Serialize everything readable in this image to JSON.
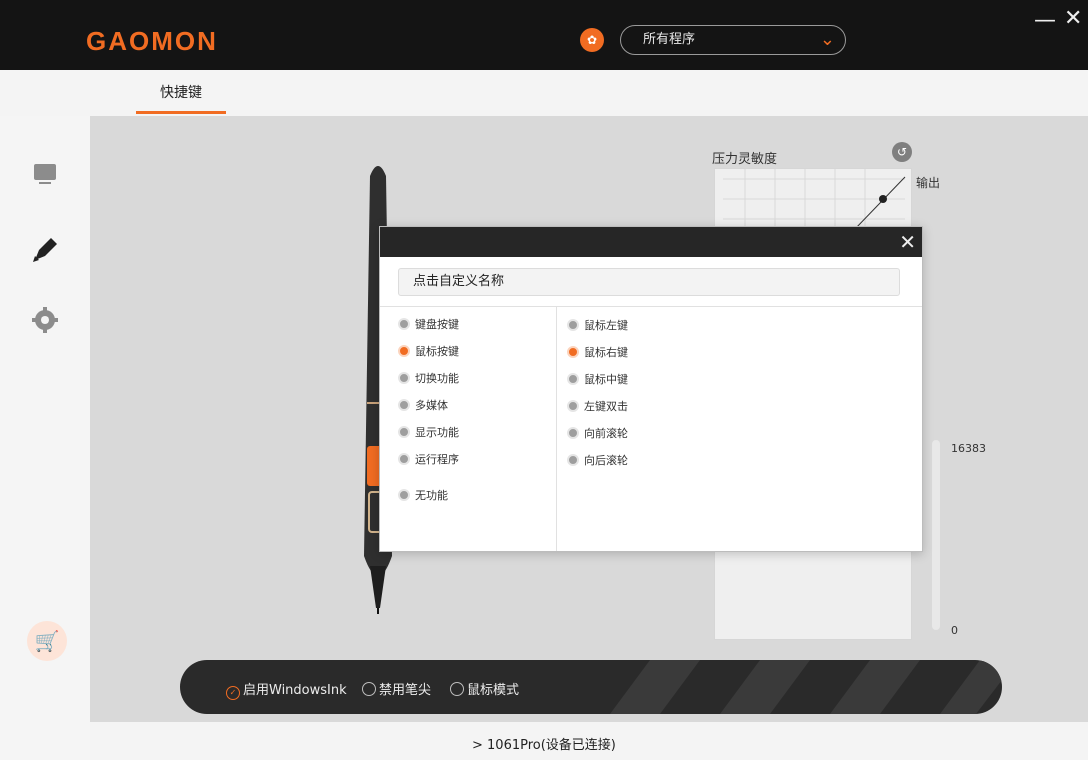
{
  "app": {
    "logo": "GAOMON",
    "program_select_value": "所有程序",
    "window_controls": {
      "minimize": "—",
      "close": "✕"
    }
  },
  "tabs": [
    {
      "label": "快捷键",
      "active": true
    }
  ],
  "sidebar": {
    "items": [
      {
        "icon": "monitor-icon"
      },
      {
        "icon": "pen-icon",
        "active": true
      },
      {
        "icon": "gear-icon"
      }
    ],
    "cart_icon": "cart-icon"
  },
  "pressure": {
    "title": "压力灵敏度",
    "output_label": "输出",
    "max_value": "16383",
    "min_value": "0"
  },
  "dialog": {
    "name_value": "点击自定义名称",
    "categories": [
      {
        "label": "键盘按键",
        "selected": false
      },
      {
        "label": "鼠标按键",
        "selected": true
      },
      {
        "label": "切换功能",
        "selected": false
      },
      {
        "label": "多媒体",
        "selected": false
      },
      {
        "label": "显示功能",
        "selected": false
      },
      {
        "label": "运行程序",
        "selected": false
      },
      {
        "label": "无功能",
        "selected": false
      }
    ],
    "mouse_options": [
      {
        "label": "鼠标左键",
        "selected": false
      },
      {
        "label": "鼠标右键",
        "selected": true
      },
      {
        "label": "鼠标中键",
        "selected": false
      },
      {
        "label": "左键双击",
        "selected": false
      },
      {
        "label": "向前滚轮",
        "selected": false
      },
      {
        "label": "向后滚轮",
        "selected": false
      }
    ]
  },
  "bottom_options": [
    {
      "label": "启用WindowsInk",
      "checked": true
    },
    {
      "label": "禁用笔尖",
      "checked": false
    },
    {
      "label": "鼠标模式",
      "checked": false
    }
  ],
  "device_status": "1061Pro(设备已连接)",
  "colors": {
    "accent": "#f16c22",
    "topbar": "#141414",
    "dark_bar": "#2a2a2a"
  }
}
